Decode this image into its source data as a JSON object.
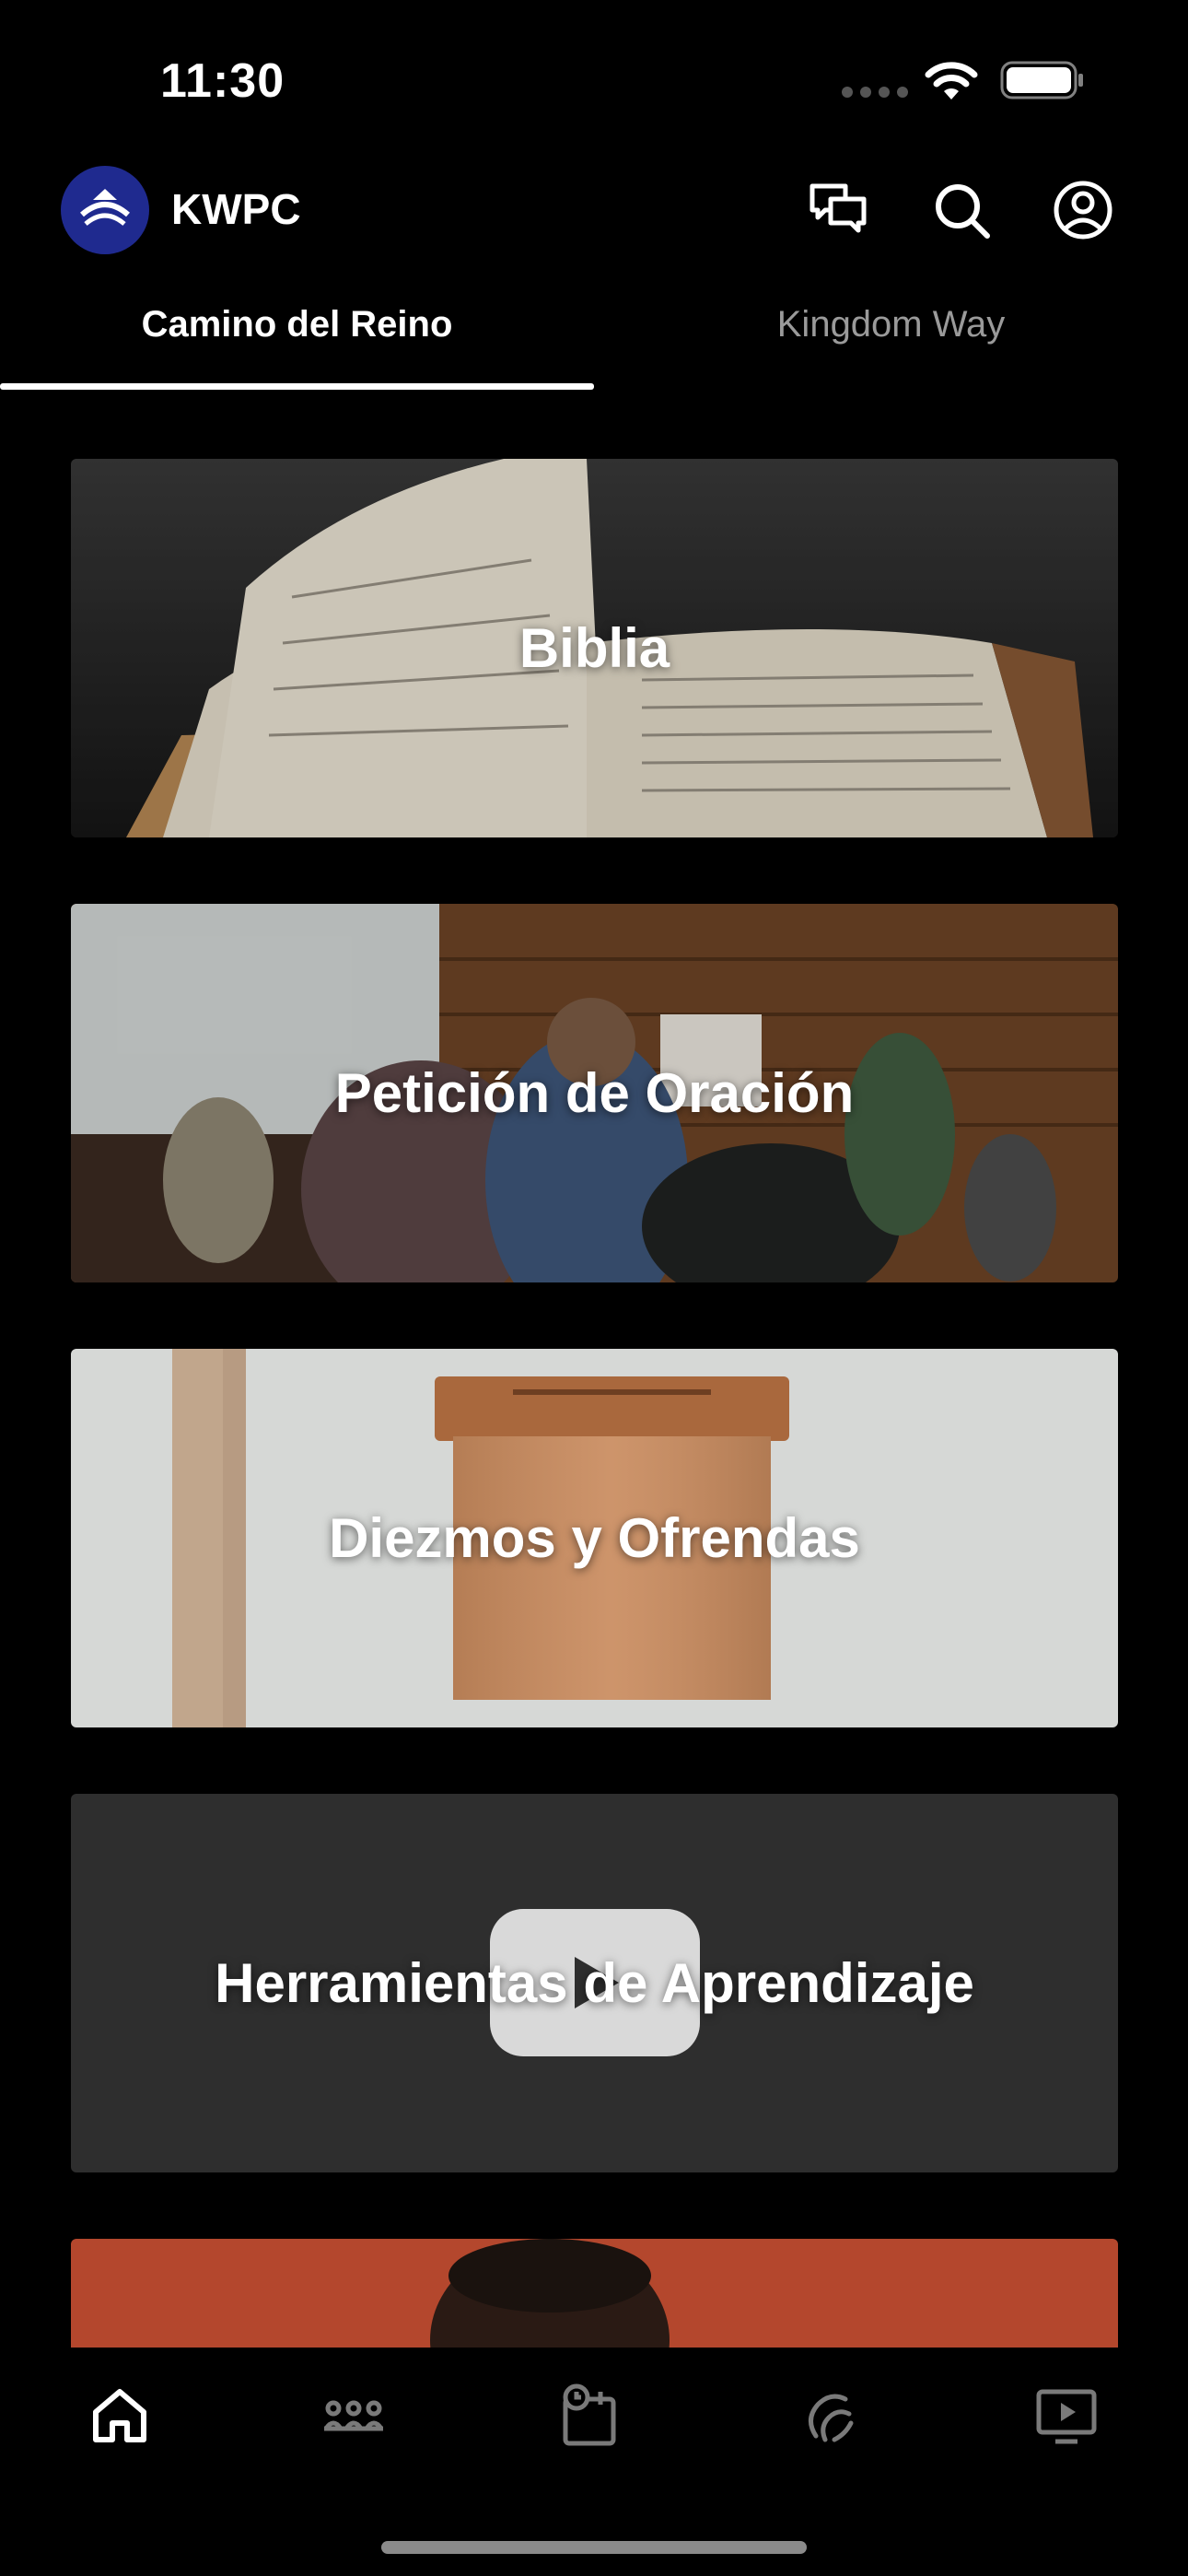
{
  "status_bar": {
    "time": "11:30"
  },
  "header": {
    "app_title": "KWPC",
    "icons": [
      "chat-bubbles-icon",
      "search-icon",
      "account-icon"
    ]
  },
  "tabs": [
    {
      "label": "Camino del Reino",
      "active": true
    },
    {
      "label": "Kingdom Way",
      "active": false
    }
  ],
  "cards": [
    {
      "label": "Biblia",
      "image": "open-bible"
    },
    {
      "label": "Petición de Oración",
      "image": "prayer-gathering"
    },
    {
      "label": "Diezmos y Ofrendas",
      "image": "wooden-offering-box"
    },
    {
      "label": "Herramientas de Aprendizaje",
      "image": "video-play"
    }
  ],
  "bottom_nav": {
    "items": [
      {
        "icon": "home-icon",
        "active": true
      },
      {
        "icon": "groups-icon",
        "active": false
      },
      {
        "icon": "events-icon",
        "active": false
      },
      {
        "icon": "giving-icon",
        "active": false
      },
      {
        "icon": "media-icon",
        "active": false
      }
    ]
  },
  "colors": {
    "background": "#000000",
    "accent": "#1f2a8f",
    "tab_inactive": "#9a9a9a"
  }
}
